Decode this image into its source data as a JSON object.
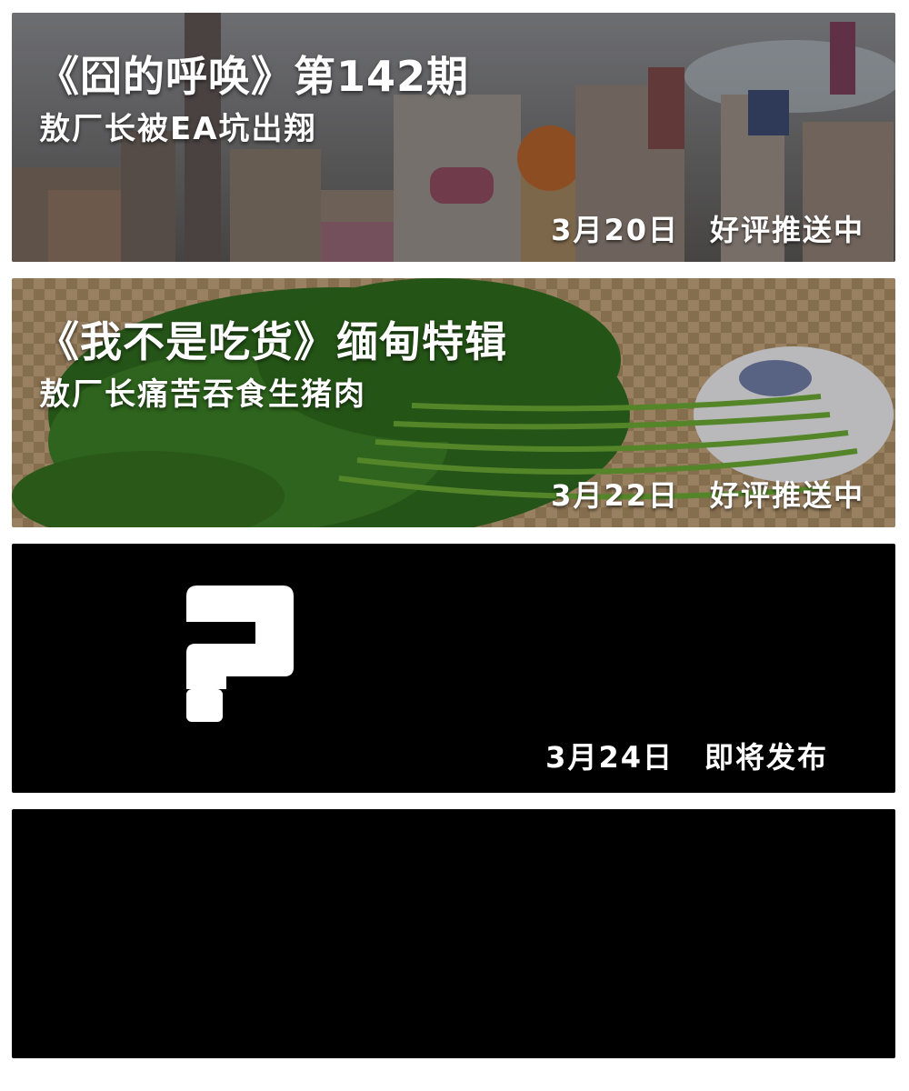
{
  "banners": [
    {
      "title": "《囧的呼唤》第142期",
      "subtitle": "敖厂长被EA坑出翔",
      "date": "3月20日",
      "status": "好评推送中",
      "background_icon": "city-skyline-image"
    },
    {
      "title": "《我不是吃货》缅甸特辑",
      "subtitle": "敖厂长痛苦吞食生猪肉",
      "date": "3月22日",
      "status": "好评推送中",
      "background_icon": "cilantro-image"
    },
    {
      "date": "3月24日",
      "status": "即将发布",
      "icon": "question-mark-icon"
    },
    {
      "icon": "blank-black-panel"
    }
  ],
  "colors": {
    "text": "#ffffff",
    "panel": "#000000"
  }
}
